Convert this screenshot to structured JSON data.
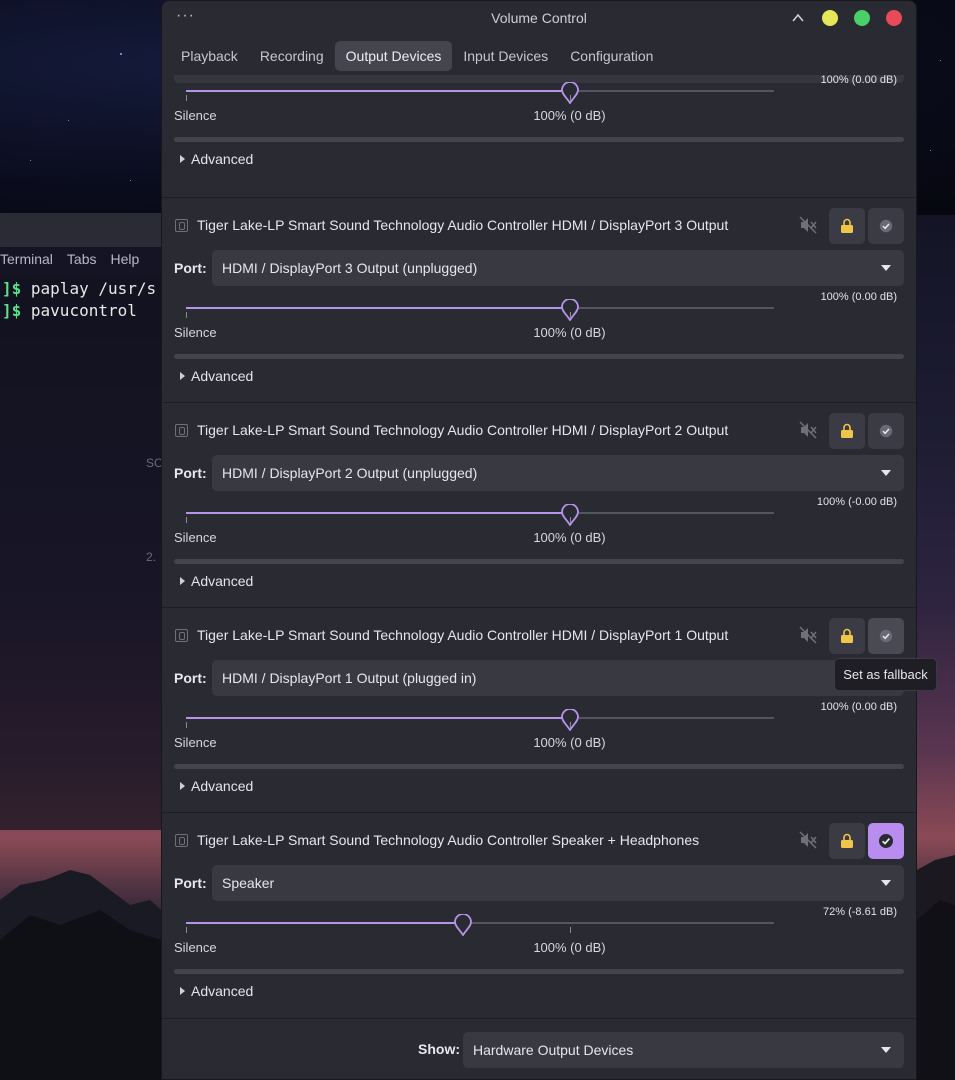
{
  "window": {
    "title": "Volume Control",
    "menu_icon": "hamburger-dots-icon"
  },
  "tabs": [
    {
      "label": "Playback",
      "active": false
    },
    {
      "label": "Recording",
      "active": false
    },
    {
      "label": "Output Devices",
      "active": true
    },
    {
      "label": "Input Devices",
      "active": false
    },
    {
      "label": "Configuration",
      "active": false
    }
  ],
  "terminal": {
    "menu": [
      "Terminal",
      "Tabs",
      "Help"
    ],
    "lines": [
      {
        "prompt": "]$",
        "command": "paplay /usr/s"
      },
      {
        "prompt": "]$",
        "command": "pavucontrol"
      }
    ],
    "faint_text": [
      "SC",
      "2."
    ]
  },
  "labels": {
    "port": "Port:",
    "silence": "Silence",
    "hundred": "100% (0 dB)",
    "advanced": "Advanced",
    "show": "Show:"
  },
  "devices": [
    {
      "name": "",
      "port": "",
      "volume_pct": 100,
      "readout": "100% (0.00 dB)",
      "fallback": false,
      "partial": true
    },
    {
      "name": "Tiger Lake-LP Smart Sound Technology Audio Controller HDMI / DisplayPort 3 Output",
      "port": "HDMI / DisplayPort 3 Output (unplugged)",
      "volume_pct": 100,
      "readout": "100% (0.00 dB)",
      "fallback": false
    },
    {
      "name": "Tiger Lake-LP Smart Sound Technology Audio Controller HDMI / DisplayPort 2 Output",
      "port": "HDMI / DisplayPort 2 Output (unplugged)",
      "volume_pct": 100,
      "readout": "100% (-0.00 dB)",
      "fallback": false
    },
    {
      "name": "Tiger Lake-LP Smart Sound Technology Audio Controller HDMI / DisplayPort 1 Output",
      "port": "HDMI / DisplayPort 1 Output (plugged in)",
      "volume_pct": 100,
      "readout": "100% (0.00 dB)",
      "fallback": false
    },
    {
      "name": "Tiger Lake-LP Smart Sound Technology Audio Controller Speaker + Headphones",
      "port": "Speaker",
      "volume_pct": 72,
      "readout": "72% (-8.61 dB)",
      "fallback": true
    }
  ],
  "show": {
    "value": "Hardware Output Devices"
  },
  "tooltip": {
    "text": "Set as fallback"
  },
  "colors": {
    "accent": "#b594e9",
    "fallback_active": "#b98cf0",
    "lock": "#f0c64a",
    "close": "#e84a5a",
    "maximize": "#4ccf6a",
    "minimize": "#e6e65a"
  }
}
